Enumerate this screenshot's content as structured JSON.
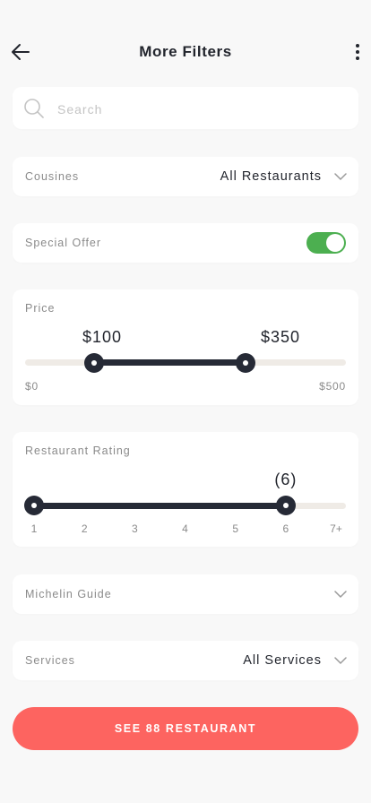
{
  "header": {
    "title": "More Filters",
    "back_icon": "arrow-left-icon",
    "menu_icon": "more-vertical-icon"
  },
  "search": {
    "placeholder": "Search",
    "value": "",
    "icon": "search-icon"
  },
  "cuisines": {
    "label": "Cousines",
    "value": "All Restaurants",
    "icon": "chevron-down-icon"
  },
  "special_offer": {
    "label": "Special Offer",
    "enabled": true,
    "on_color": "#4caf50"
  },
  "price": {
    "label": "Price",
    "min_label": "$0",
    "max_label": "$500",
    "min": 0,
    "max": 500,
    "low": 100,
    "high": 350,
    "low_label": "$100",
    "high_label": "$350"
  },
  "rating": {
    "label": "Restaurant Rating",
    "selected_label": "(6)",
    "low": 1,
    "high": 6,
    "ticks": [
      "1",
      "2",
      "3",
      "4",
      "5",
      "6",
      "7+"
    ]
  },
  "michelin": {
    "label": "Michelin Guide",
    "icon": "chevron-down-icon"
  },
  "services": {
    "label": "Services",
    "value": "All Services",
    "icon": "chevron-down-icon"
  },
  "cta": {
    "label": "SEE 88 RESTAURANT",
    "color": "#fd6460"
  },
  "colors": {
    "slider_fill": "#262a36",
    "slider_track": "#efebe6",
    "background": "#f8f8f8"
  }
}
